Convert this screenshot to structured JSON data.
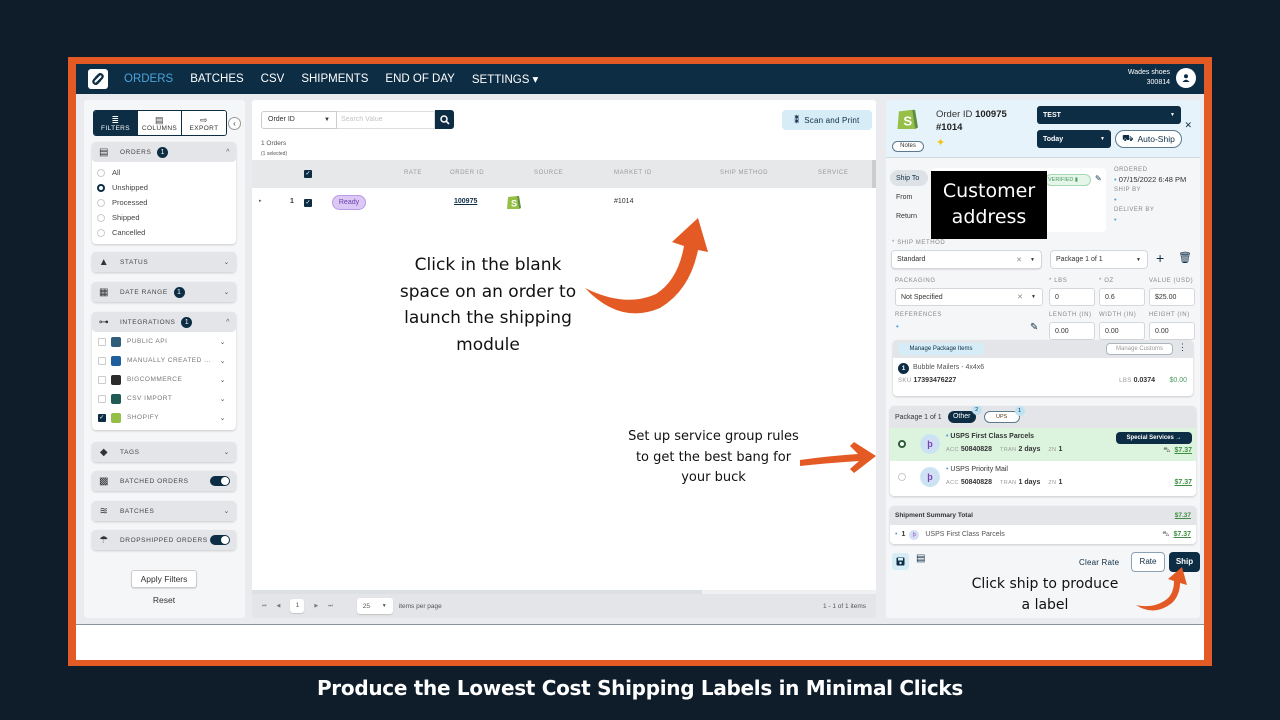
{
  "nav": {
    "items": [
      {
        "label": "ORDERS",
        "active": true
      },
      {
        "label": "BATCHES"
      },
      {
        "label": "CSV"
      },
      {
        "label": "SHIPMENTS"
      },
      {
        "label": "END OF DAY"
      },
      {
        "label": "SETTINGS ▾"
      }
    ],
    "user": {
      "name": "Wades shoes",
      "account": "300814"
    }
  },
  "sidebar": {
    "tabs": [
      {
        "label": "FILTERS",
        "icon": "filter-icon",
        "glyph": "≣"
      },
      {
        "label": "COLUMNS",
        "icon": "columns-icon",
        "glyph": "▤"
      },
      {
        "label": "EXPORT",
        "icon": "export-icon",
        "glyph": "⇨"
      }
    ],
    "collapse_glyph": "‹",
    "orders_filter": {
      "label": "ORDERS",
      "badge": "1",
      "options": [
        {
          "label": "All",
          "selected": false
        },
        {
          "label": "Unshipped",
          "selected": true
        },
        {
          "label": "Processed",
          "selected": false
        },
        {
          "label": "Shipped",
          "selected": false
        },
        {
          "label": "Cancelled",
          "selected": false
        }
      ]
    },
    "status": {
      "label": "STATUS"
    },
    "date_range": {
      "label": "DATE RANGE",
      "badge": "1"
    },
    "integrations": {
      "label": "INTEGRATIONS",
      "badge": "1",
      "items": [
        {
          "label": "PUBLIC API",
          "checked": false,
          "color": "#2f5d7a"
        },
        {
          "label": "MANUALLY CREATED ...",
          "checked": false,
          "color": "#1f5f9e"
        },
        {
          "label": "BIGCOMMERCE",
          "checked": false,
          "color": "#2b2b2b"
        },
        {
          "label": "CSV IMPORT",
          "checked": false,
          "color": "#1f5a55"
        },
        {
          "label": "SHOPIFY",
          "checked": true,
          "color": "#95bf47"
        }
      ]
    },
    "tags": {
      "label": "TAGS"
    },
    "batched_orders": {
      "label": "BATCHED ORDERS",
      "enabled": true
    },
    "batches": {
      "label": "BATCHES"
    },
    "dropshipped_orders": {
      "label": "DROPSHIPPED ORDERS",
      "enabled": true
    },
    "apply_label": "Apply Filters",
    "reset_label": "Reset"
  },
  "orders": {
    "search_field": "Order ID",
    "search_placeholder": "Search Value",
    "scan_print_label": "Scan and Print",
    "count_label": "1 Orders",
    "selected_label": "(1 selected)",
    "columns": [
      "RATE",
      "ORDER ID",
      "SOURCE",
      "MARKET ID",
      "SHIP METHOD",
      "SERVICE"
    ],
    "rows": [
      {
        "index": "1",
        "checked": true,
        "status": "Ready",
        "rate": "",
        "order_id": "100975",
        "source": "Shopify",
        "market_id": "#1014",
        "ship_method": "",
        "service": ""
      }
    ],
    "pager": {
      "page": "1",
      "page_size": "25",
      "per_page_label": "items per page",
      "range": "1 - 1 of 1 items"
    }
  },
  "shipping": {
    "notes_label": "Notes",
    "order_id_prefix": "Order ID",
    "order_id": "100975",
    "market_id": "#1014",
    "account_select": "TEST",
    "date_select": "Today",
    "autoship_label": "Auto-Ship",
    "address_tabs": [
      "Ship To",
      "From",
      "Return"
    ],
    "address_redaction": "Customer address",
    "verified_label": "VERIFIED",
    "ordered_label": "ORDERED",
    "ordered_value": "07/15/2022 6:48 PM",
    "ship_by_label": "SHIP BY",
    "ship_by_value": "",
    "deliver_by_label": "DELIVER BY",
    "deliver_by_value": "",
    "ship_method_label": "* SHIP METHOD",
    "ship_method_value": "Standard",
    "package_select": "Package 1 of 1",
    "packaging_label": "PACKAGING",
    "packaging_value": "Not Specified",
    "lbs_label": "* LBS",
    "lbs_value": "0",
    "oz_label": "* OZ",
    "oz_value": "0.6",
    "value_label": "VALUE (USD)",
    "value_value": "$25.00",
    "references_label": "REFERENCES",
    "length_label": "LENGTH (IN)",
    "length_value": "0.00",
    "width_label": "WIDTH (IN)",
    "width_value": "0.00",
    "height_label": "HEIGHT (IN)",
    "height_value": "0.00",
    "manage_items_label": "Manage Package Items",
    "manage_customs_label": "Manage Customs",
    "items": [
      {
        "qty": "1",
        "name": "Bubble Mailers - 4x4x6",
        "sku_label": "SKU",
        "sku": "17393476227",
        "lbs_label": "LBS",
        "lbs": "0.0374",
        "price": "$0.00"
      }
    ],
    "rates_header": "Package 1 of 1",
    "groups": [
      {
        "label": "Other",
        "count": "2",
        "active": true
      },
      {
        "label": "UPS",
        "count": "1",
        "active": false
      }
    ],
    "rates": [
      {
        "service": "USPS First Class Parcels",
        "acc": "50840828",
        "tran": "2 days",
        "zn": "1",
        "price": "$7.37",
        "selected": true,
        "special_services_label": "Special Services →"
      },
      {
        "service": "USPS Priority Mail",
        "acc": "50840828",
        "tran": "1 days",
        "zn": "1",
        "price": "$7.37",
        "selected": false
      }
    ],
    "rate_meta_labels": {
      "acc": "ACC",
      "tran": "TRAN",
      "zn": "ZN"
    },
    "summary_label": "Shipment Summary Total",
    "summary_total": "$7.37",
    "summary_rows": [
      {
        "qty": "1",
        "service": "USPS First Class Parcels",
        "price": "$7.37"
      }
    ],
    "clear_rate_label": "Clear Rate",
    "rate_label": "Rate",
    "ship_label": "Ship"
  },
  "annotations": {
    "launch": "Click in the blank space on an order to launch the shipping module",
    "service_groups": "Set up service group rules to get the best bang for your buck",
    "ship": "Click ship to produce a label"
  },
  "caption": "Produce the Lowest Cost Shipping Labels in Minimal Clicks",
  "colors": {
    "frame": "#e35a25",
    "nav": "#0d2d44",
    "accent": "#4ba3d9",
    "background": "#0e1d29",
    "success": "#3e8e41"
  }
}
